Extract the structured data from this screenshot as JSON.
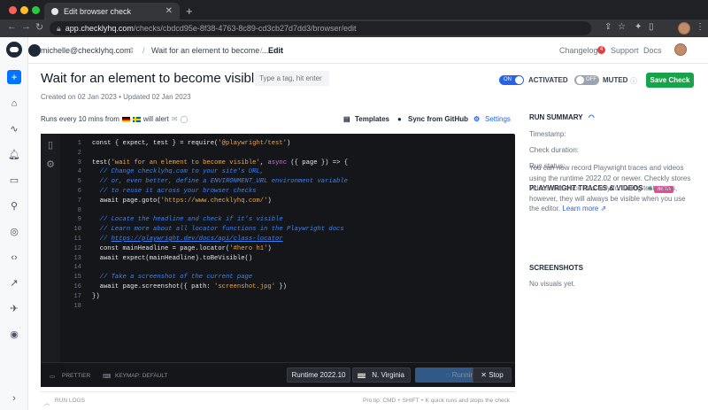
{
  "browser": {
    "tab_title": "Edit browser check",
    "url_host": "app.checklyhq.com",
    "url_path": "/checks/cbdcd95e-8f38-4763-8c89-cd3cb27d7dd3/browser/edit"
  },
  "topbar": {
    "account": "michelle@checklyhq.com",
    "breadcrumb_1": "Wait for an element to become ...",
    "breadcrumb_2": "Edit",
    "changelog": "Changelog",
    "changelog_count": "4",
    "support": "Support",
    "docs": "Docs"
  },
  "check": {
    "title": "Wait for an element to become visible",
    "tag_placeholder": "Type a tag, hit enter",
    "meta": "Created on 02 Jan 2023 • Updated 02 Jan 2023",
    "activated_toggle": "ON",
    "activated_label": "ACTIVATED",
    "muted_toggle": "OFF",
    "muted_label": "MUTED",
    "save": "Save Check",
    "runs_prefix": "Runs every 10 mins from",
    "runs_suffix": "will alert",
    "templates": "Templates",
    "sync": "Sync from GitHub",
    "settings": "Settings"
  },
  "editor": {
    "lines": [
      {
        "n": "1",
        "parts": [
          [
            "tk",
            "const { expect, test } = require("
          ],
          [
            "st",
            "'@playwright/test'"
          ],
          [
            "tk",
            ")"
          ]
        ]
      },
      {
        "n": "2",
        "parts": []
      },
      {
        "n": "3",
        "parts": [
          [
            "tk",
            "test("
          ],
          [
            "st",
            "'wait for an element to become visible'"
          ],
          [
            "tk",
            ", "
          ],
          [
            "kw",
            "async"
          ],
          [
            "tk",
            " ({ page }) => {"
          ]
        ]
      },
      {
        "n": "4",
        "parts": [
          [
            "tk",
            "  "
          ],
          [
            "cm",
            "// Change checklyhq.com to your site's URL,"
          ]
        ]
      },
      {
        "n": "5",
        "parts": [
          [
            "tk",
            "  "
          ],
          [
            "cm",
            "// or, even better, define a ENVIRONMENT_URL environment variable"
          ]
        ]
      },
      {
        "n": "6",
        "parts": [
          [
            "tk",
            "  "
          ],
          [
            "cm",
            "// to reuse it across your browser checks"
          ]
        ]
      },
      {
        "n": "7",
        "parts": [
          [
            "tk",
            "  await page.goto("
          ],
          [
            "st",
            "'https://www.checklyhq.com/'"
          ],
          [
            "tk",
            ")"
          ]
        ]
      },
      {
        "n": "8",
        "parts": []
      },
      {
        "n": "9",
        "parts": [
          [
            "tk",
            "  "
          ],
          [
            "cm",
            "// Locate the headline and check if it's visible"
          ]
        ]
      },
      {
        "n": "10",
        "parts": [
          [
            "tk",
            "  "
          ],
          [
            "cm",
            "// Learn more about all locator functions in the Playwright docs"
          ]
        ]
      },
      {
        "n": "11",
        "parts": [
          [
            "tk",
            "  "
          ],
          [
            "cm",
            "// "
          ],
          [
            "lk",
            "https://playwright.dev/docs/api/class-locator"
          ]
        ]
      },
      {
        "n": "12",
        "parts": [
          [
            "tk",
            "  const mainHeadline = page.locator("
          ],
          [
            "st",
            "'#hero h1'"
          ],
          [
            "tk",
            ")"
          ]
        ]
      },
      {
        "n": "13",
        "parts": [
          [
            "tk",
            "  await expect(mainHeadline).toBeVisible()"
          ]
        ]
      },
      {
        "n": "14",
        "parts": []
      },
      {
        "n": "15",
        "parts": [
          [
            "tk",
            "  "
          ],
          [
            "cm",
            "// Take a screenshot of the current page"
          ]
        ]
      },
      {
        "n": "16",
        "parts": [
          [
            "tk",
            "  await page.screenshot({ path: "
          ],
          [
            "st",
            "'screenshot.jpg'"
          ],
          [
            "tk",
            " })"
          ]
        ]
      },
      {
        "n": "17",
        "parts": [
          [
            "tk",
            "})"
          ]
        ]
      },
      {
        "n": "18",
        "parts": []
      }
    ],
    "prettier": "PRETTIER",
    "keymap": "KEYMAP: DEFAULT",
    "runtime": "Runtime 2022.10",
    "location": "N. Virginia",
    "run": "Running",
    "stop": "Stop"
  },
  "footer": {
    "run_logs": "RUN LOGS",
    "tip": "Pro tip: CMD + SHIFT + K quick runs and stops the check"
  },
  "summary": {
    "title": "RUN SUMMARY",
    "timestamp": "Timestamp:",
    "duration": "Check duration:",
    "status": "Run status:",
    "pw_title": "PLAYWRIGHT TRACES & VIDEOS",
    "beta": "BETA",
    "pw_text": "You can now record Playwright traces and videos using the runtime 2022.02 or newer. Checkly stores videos and trace files only for failing test cases, however, they will always be visible when you use the editor.",
    "learn_more": "Learn more",
    "screenshots_title": "SCREENSHOTS",
    "no_visuals": "No visuals yet."
  }
}
